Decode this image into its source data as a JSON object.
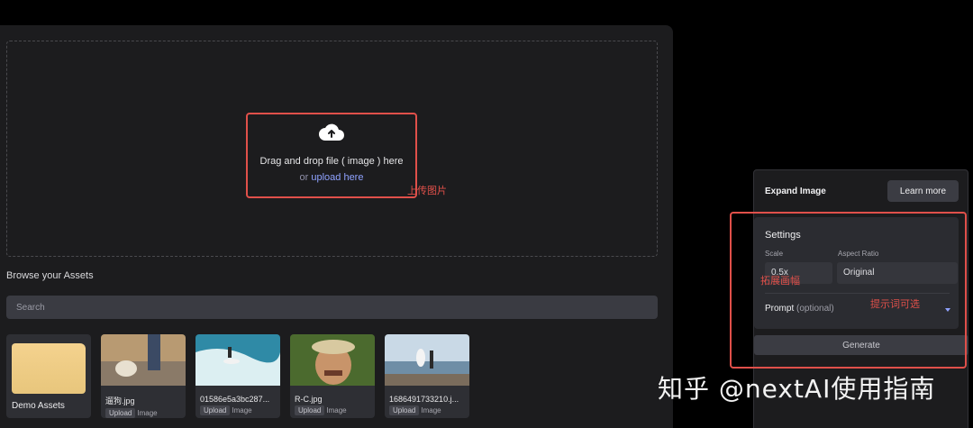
{
  "upload": {
    "drag_text": "Drag and drop file ( image ) here",
    "or_text": "or ",
    "link_text": "upload here"
  },
  "assets": {
    "browse_label": "Browse your Assets",
    "search_placeholder": "Search",
    "folder_name": "Demo Assets",
    "items": [
      {
        "name": "遛狗.jpg",
        "tag": "Upload",
        "type": "Image"
      },
      {
        "name": "01586e5a3bc287...",
        "tag": "Upload",
        "type": "Image"
      },
      {
        "name": "R-C.jpg",
        "tag": "Upload",
        "type": "Image"
      },
      {
        "name": "1686491733210.j...",
        "tag": "Upload",
        "type": "Image"
      }
    ]
  },
  "expand": {
    "title": "Expand Image",
    "learn_more": "Learn more",
    "settings_title": "Settings",
    "scale_label": "Scale",
    "scale_value": "0.5x",
    "aspect_label": "Aspect Ratio",
    "aspect_value": "Original",
    "prompt_label": "Prompt",
    "prompt_optional": "(optional)",
    "generate": "Generate"
  },
  "annotations": {
    "upload": "上传图片",
    "scale": "拓展画幅",
    "prompt": "提示词可选",
    "color": "#e0504a"
  },
  "watermark": "知乎 @nextAI使用指南",
  "colors": {
    "accent": "#8fa2ff",
    "panel": "#1c1c1e",
    "annotation": "#e0504a"
  }
}
